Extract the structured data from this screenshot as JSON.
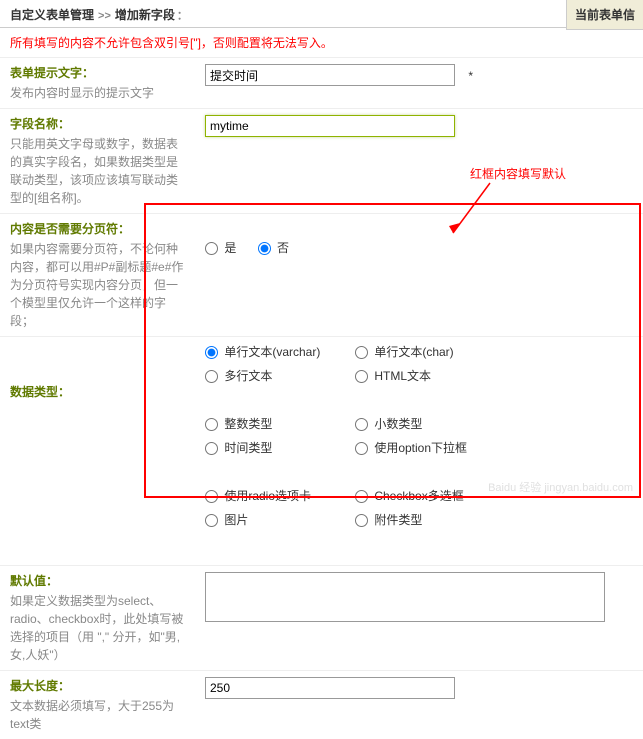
{
  "header": {
    "crumb1": "自定义表单管理",
    "crumb2": "增加新字段",
    "rtab": "当前表单信"
  },
  "warning": "所有填写的内容不允许包含双引号[\"]，否则配置将无法写入。",
  "fields": {
    "hint": {
      "title": "表单提示文字：",
      "desc": "发布内容时显示的提示文字",
      "value": "提交时间",
      "req": "*"
    },
    "name": {
      "title": "字段名称：",
      "desc": "只能用英文字母或数字，数据表的真实字段名，如果数据类型是联动类型，该项应该填写联动类型的[组名称]。",
      "value": "mytime"
    },
    "paging": {
      "title": "内容是否需要分页符：",
      "desc": "如果内容需要分页符，不论何种内容，都可以用#P#副标题#e#作为分页符号实现内容分页，但一个模型里仅允许一个这样的字段；",
      "yes": "是",
      "no": "否",
      "selected": "no"
    },
    "dtype": {
      "title": "数据类型：",
      "options": [
        "单行文本(varchar)",
        "单行文本(char)",
        "多行文本",
        "HTML文本",
        "",
        "",
        "整数类型",
        "小数类型",
        "时间类型",
        "使用option下拉框",
        "",
        "",
        "使用radio选项卡",
        "Checkbox多选框",
        "图片",
        "附件类型",
        "",
        ""
      ],
      "selected": 0
    },
    "default": {
      "title": "默认值：",
      "desc": "如果定义数据类型为select、radio、checkbox时，此处填写被选择的项目（用 \",\" 分开，如\"男,女,人妖\"）",
      "value": ""
    },
    "maxlen": {
      "title": "最大长度：",
      "desc": "文本数据必须填写，大于255为text类",
      "value": "250"
    }
  },
  "annotation": "红框内容填写默认",
  "watermark": "Baidu 经验 jingyan.baidu.com"
}
